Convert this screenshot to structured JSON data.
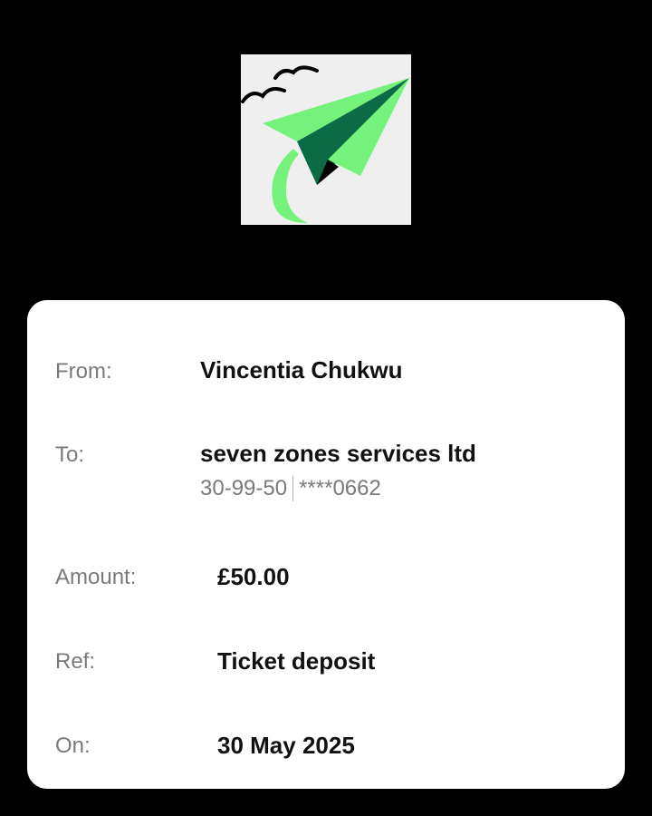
{
  "brand": {
    "logo_icon": "paper-plane-logo-icon",
    "colors": {
      "plane_light": "#74f27c",
      "plane_dark": "#0b6b45",
      "logo_bg": "#efefef"
    }
  },
  "receipt": {
    "from_label": "From:",
    "from_value": "Vincentia Chukwu",
    "to_label": "To:",
    "to_value": "seven zones services ltd",
    "to_sort_code": "30-99-50",
    "to_account": "****0662",
    "amount_label": "Amount:",
    "amount_value": "£50.00",
    "ref_label": "Ref:",
    "ref_value": "Ticket deposit",
    "on_label": "On:",
    "on_value": "30 May 2025"
  }
}
